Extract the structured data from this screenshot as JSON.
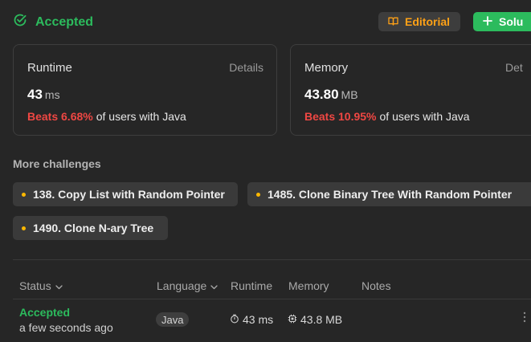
{
  "header": {
    "status": "Accepted",
    "editorial_label": "Editorial",
    "solution_label": "Solu",
    "colors": {
      "accepted": "#2cbb5d",
      "editorial": "#ffa116",
      "solution_bg": "#2cbb5d"
    }
  },
  "runtime_card": {
    "title": "Runtime",
    "details": "Details",
    "value": "43",
    "unit": "ms",
    "beats": "Beats 6.68%",
    "suffix": "of users with Java"
  },
  "memory_card": {
    "title": "Memory",
    "details": "Det",
    "value": "43.80",
    "unit": "MB",
    "beats": "Beats 10.95%",
    "suffix": "of users with Java"
  },
  "more_challenges": {
    "title": "More challenges",
    "items": [
      {
        "label": "138. Copy List with Random Pointer"
      },
      {
        "label": "1485. Clone Binary Tree With Random Pointer"
      },
      {
        "label": "1490. Clone N-ary Tree"
      }
    ]
  },
  "submissions": {
    "columns": {
      "status": "Status",
      "language": "Language",
      "runtime": "Runtime",
      "memory": "Memory",
      "notes": "Notes"
    },
    "rows": [
      {
        "status": "Accepted",
        "time": "a few seconds ago",
        "language": "Java",
        "runtime": "43 ms",
        "memory": "43.8 MB"
      }
    ]
  },
  "icons": {
    "status": "check-circle-icon",
    "editorial": "book-icon",
    "solution": "plus-icon",
    "sort": "chevron-down-icon",
    "runtime": "clock-icon",
    "memory": "chip-icon",
    "more": "more-vertical-icon"
  }
}
